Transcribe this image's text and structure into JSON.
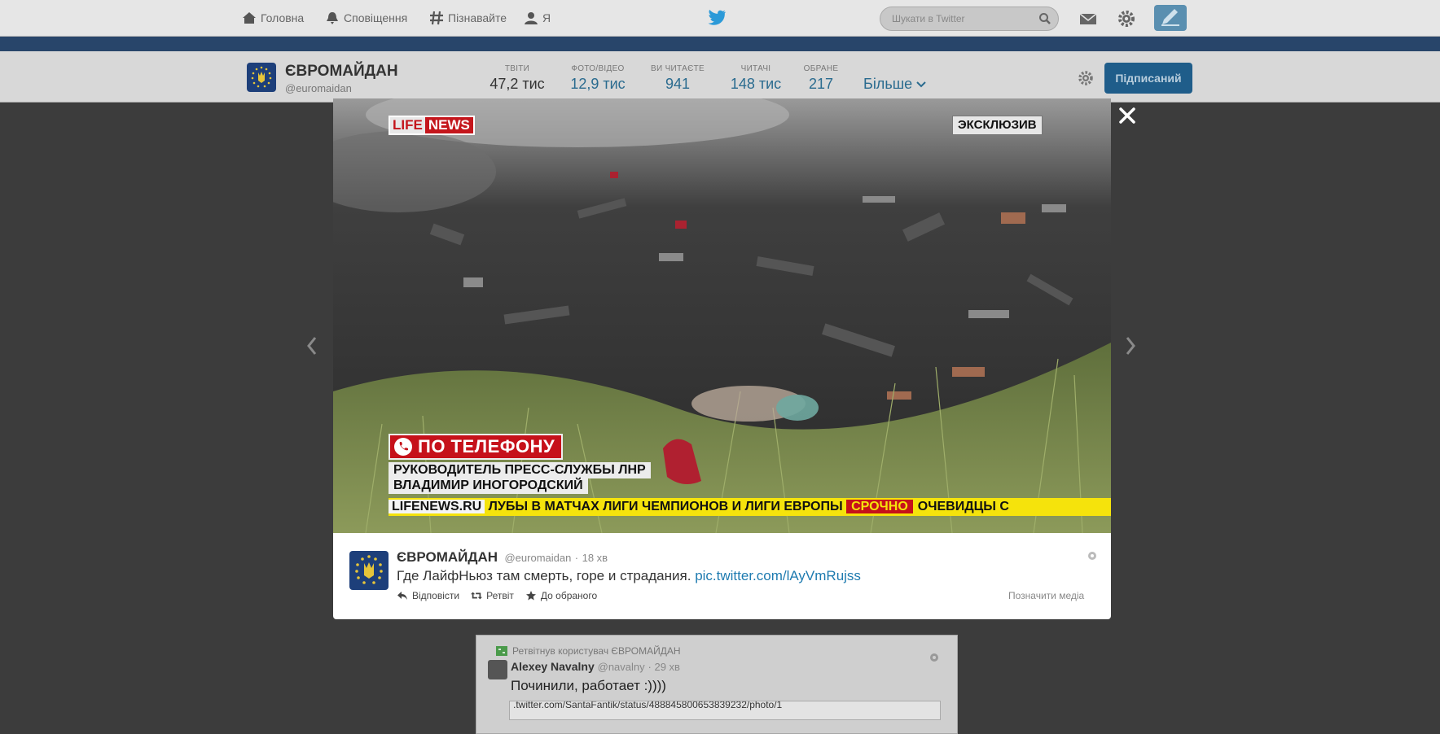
{
  "topbar": {
    "nav": [
      {
        "label": "Головна",
        "icon": "home-icon"
      },
      {
        "label": "Сповіщення",
        "icon": "bell-icon"
      },
      {
        "label": "Пізнавайте",
        "icon": "hashtag-icon"
      },
      {
        "label": "Я",
        "icon": "user-icon"
      }
    ],
    "search_placeholder": "Шукати в Twitter"
  },
  "profile": {
    "name": "ЄВРОМАЙДАН",
    "handle": "@euromaidan",
    "stats": [
      {
        "label": "Твіти",
        "value": "47,2 тис"
      },
      {
        "label": "Фото/відео",
        "value": "12,9 тис"
      },
      {
        "label": "Ви читаєте",
        "value": "941"
      },
      {
        "label": "Читачі",
        "value": "148 тис"
      },
      {
        "label": "Обране",
        "value": "217"
      }
    ],
    "more_label": "Більше",
    "follow_label": "Підписаний"
  },
  "media": {
    "logo_a": "LIFE",
    "logo_b": "NEWS",
    "exclusive": "ЭКСКЛЮЗИВ",
    "phone_label": "ПО ТЕЛЕФОНУ",
    "caption_line1": "РУКОВОДИТЕЛЬ ПРЕСС-СЛУЖБЫ ЛНР",
    "caption_line2": "ВЛАДИМИР ИНОГОРОДСКИЙ",
    "ticker_site": "LIFENEWS.RU",
    "ticker_text": " ЛУБЫ В МАТЧАХ ЛИГИ ЧЕМПИОНОВ И ЛИГИ ЕВРОПЫ ",
    "ticker_urgent": "СРОЧНО",
    "ticker_tail": "ОЧЕВИДЦЫ С"
  },
  "tweet": {
    "name": "ЄВРОМАЙДАН",
    "handle": "@euromaidan",
    "separator": "·",
    "time": "18 хв",
    "text": "Где ЛайфНьюз там смерть, горе и страдания. ",
    "link": "pic.twitter.com/lAyVmRujss",
    "actions": {
      "reply": "Відповісти",
      "retweet": "Ретвіт",
      "favorite": "До обраного"
    },
    "flag_media": "Позначити медіа"
  },
  "bg_tweet": {
    "retweet_context": "Ретвітнув користувач ЄВРОМАЙДАН",
    "name": "Alexey Navalny",
    "handle": "@navalny",
    "time": "· 29 хв",
    "text": "Починили, работает :))))",
    "link_preview": ".twitter.com/SantaFantik/status/488845800653839232/photo/1"
  },
  "colors": {
    "accent": "#1e7bb0",
    "brand_blue": "#1f5d8a",
    "lifenews_red": "#c6111a",
    "ticker_yellow": "#f5e30c"
  }
}
